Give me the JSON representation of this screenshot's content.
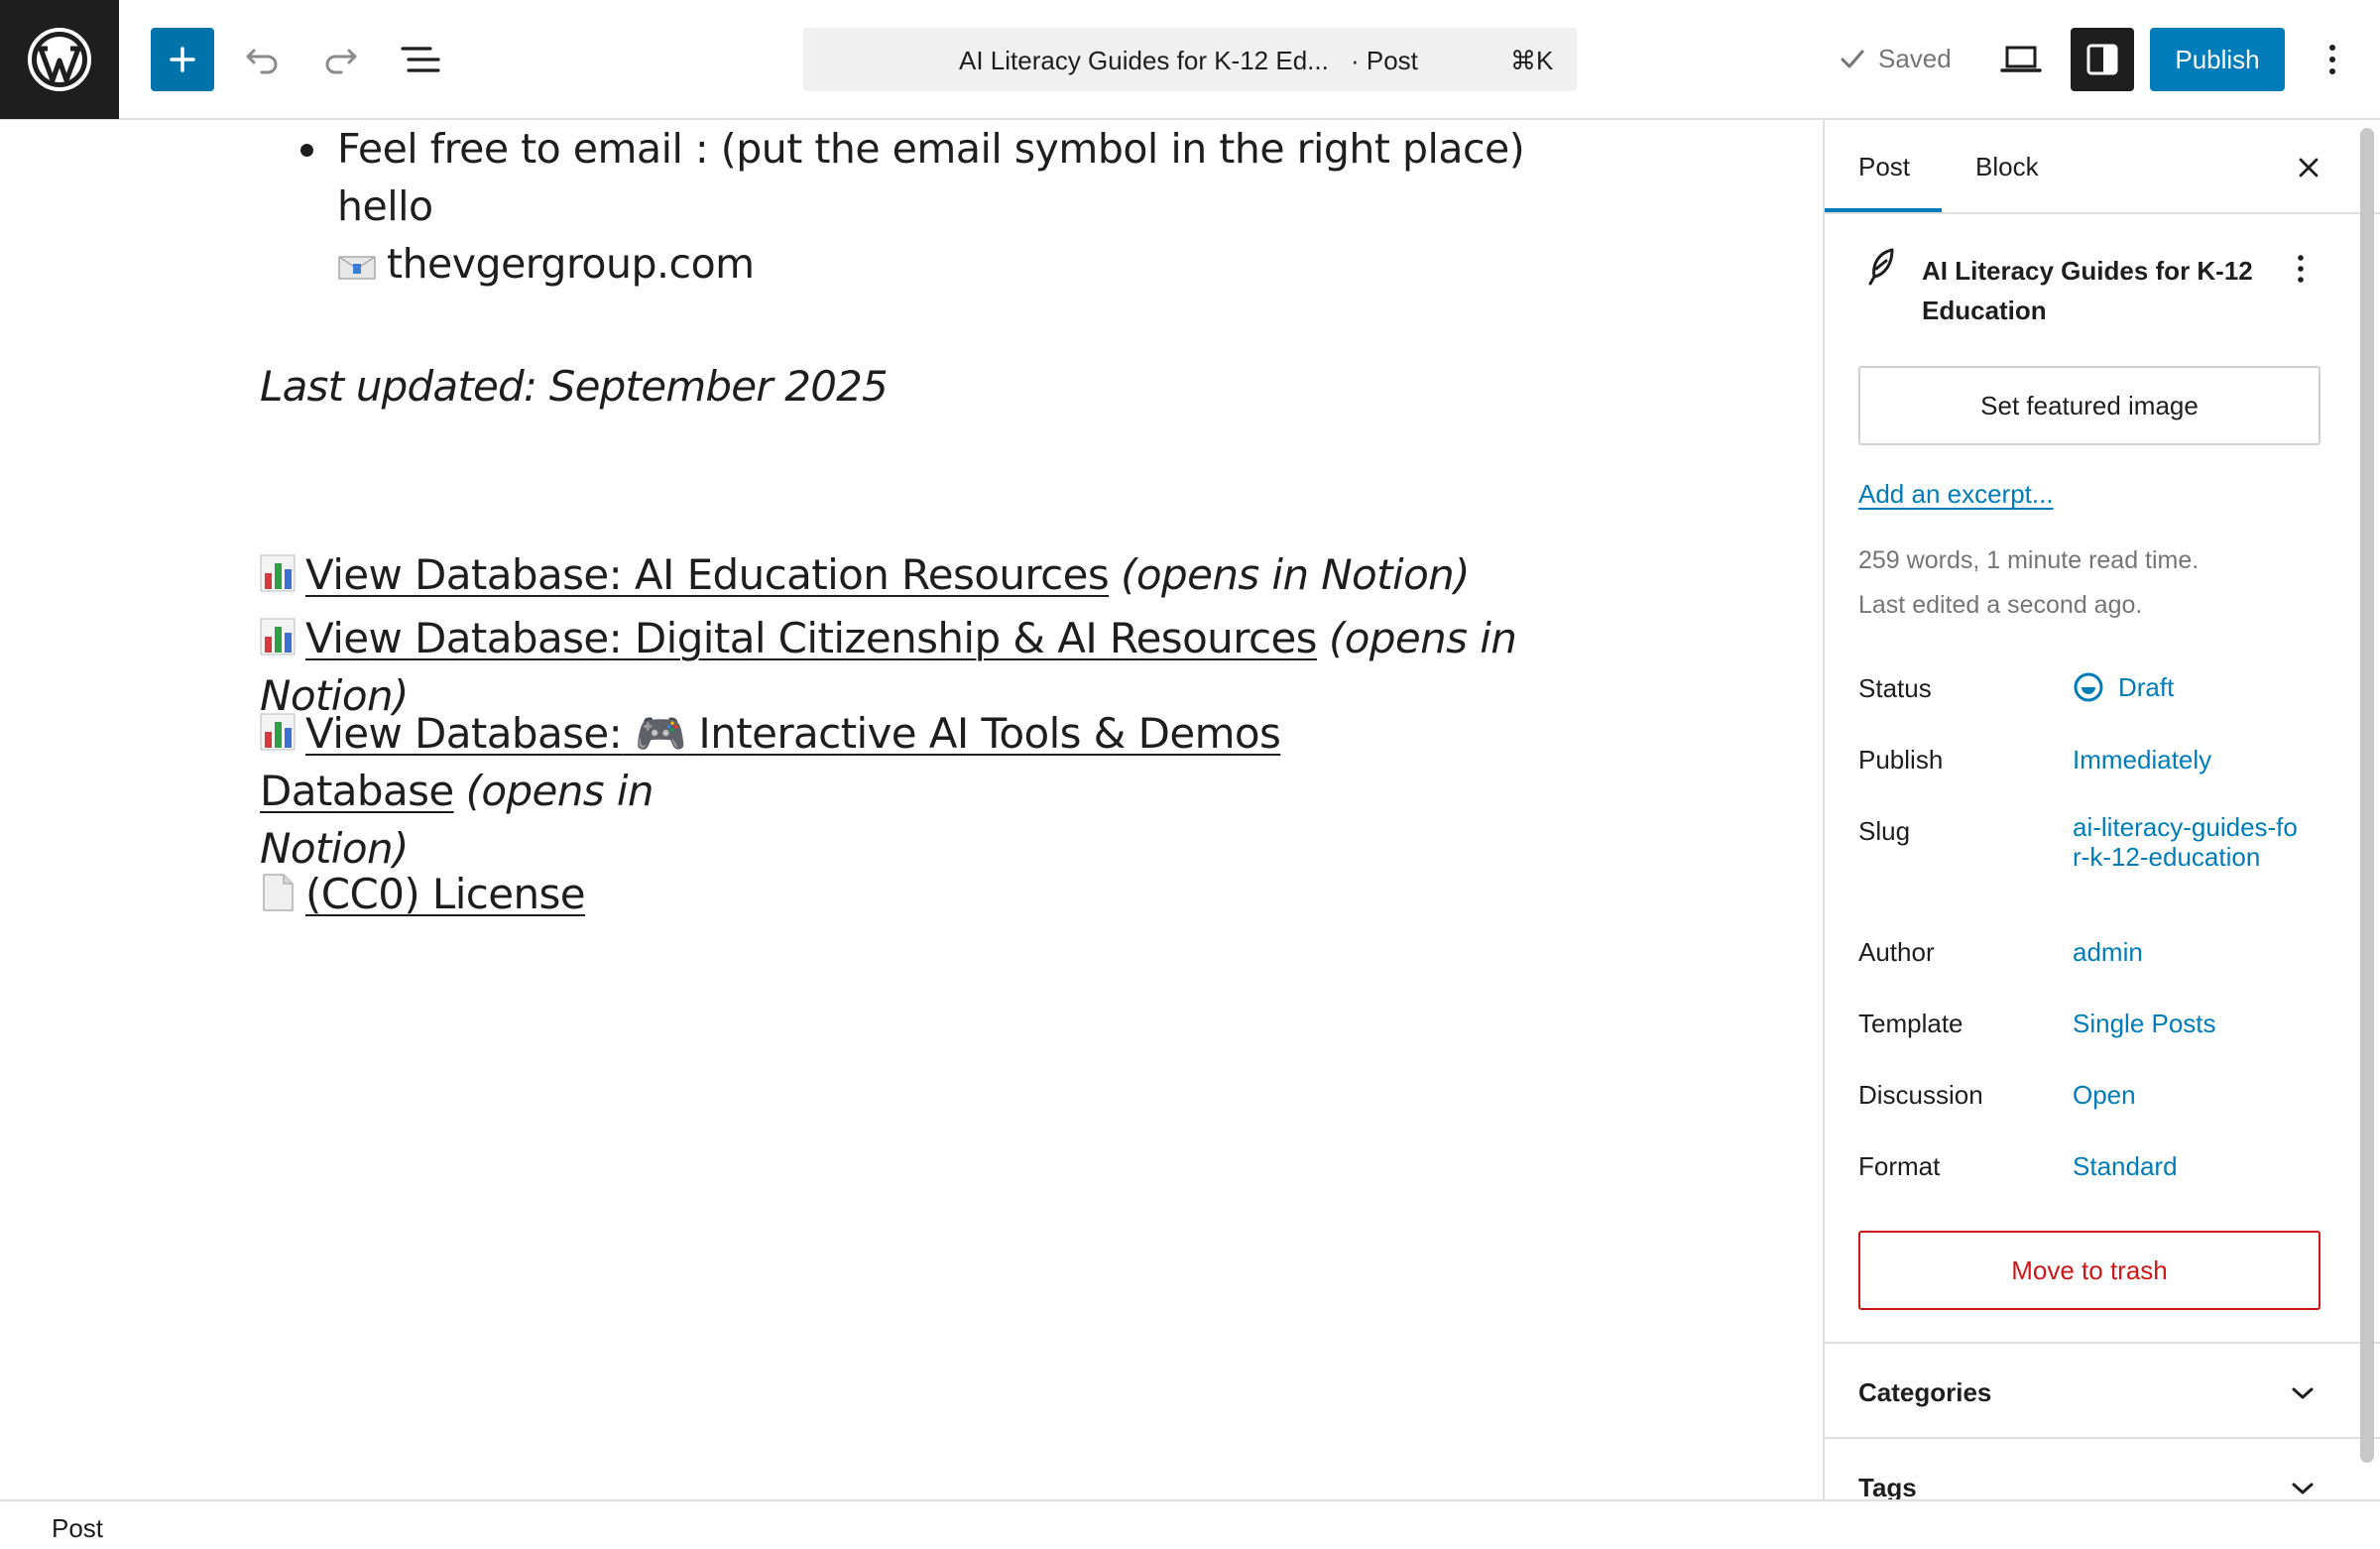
{
  "toolbar": {
    "logo_icon": "wordpress-logo-icon",
    "add_icon": "plus-icon",
    "undo_icon": "undo-icon",
    "redo_icon": "redo-icon",
    "list_view_icon": "list-view-icon",
    "command": {
      "title": "AI Literacy Guides for K-12 Ed...",
      "type": "· Post",
      "shortcut": "⌘K"
    },
    "saved_label": "Saved",
    "view_icon": "desktop-view-icon",
    "settings_icon": "sidebar-settings-icon",
    "publish_label": "Publish",
    "options_icon": "more-vertical-icon",
    "accent_color": "#007cba"
  },
  "content": {
    "bullet": {
      "line1": "Feel free to email : (put the email symbol in the right place)  hello",
      "line2": "thevgergroup.com"
    },
    "last_updated": "Last updated: September 2025",
    "databases": [
      {
        "link": "View Database: AI Education Resources",
        "note": "(opens in Notion)"
      },
      {
        "link": "View Database: Digital Citizenship & AI Resources",
        "note": "(opens in Notion)"
      },
      {
        "link_prefix": "View Database:",
        "link_emoji": "🎮",
        "link_suffix": "Interactive AI Tools & Demos Database",
        "note_part1": "(opens in",
        "note_part2": "Notion)"
      }
    ],
    "license": "(CC0) License"
  },
  "sidebar": {
    "tabs": [
      {
        "label": "Post",
        "active": true
      },
      {
        "label": "Block",
        "active": false
      }
    ],
    "post_title": "AI Literacy Guides for K-12 Education",
    "featured_image_label": "Set featured image",
    "excerpt_link": "Add an excerpt...",
    "word_count": "259 words, 1 minute read time.",
    "last_edited": "Last edited a second ago.",
    "rows": [
      {
        "label": "Status",
        "value": "Draft"
      },
      {
        "label": "Publish",
        "value": "Immediately"
      },
      {
        "label": "Slug",
        "value": "ai-literacy-guides-for-k-12-education"
      },
      {
        "label": "Author",
        "value": "admin"
      },
      {
        "label": "Template",
        "value": "Single Posts"
      },
      {
        "label": "Discussion",
        "value": "Open"
      },
      {
        "label": "Format",
        "value": "Standard"
      }
    ],
    "trash_label": "Move to trash",
    "panels": [
      {
        "title": "Categories"
      },
      {
        "title": "Tags"
      }
    ],
    "danger_color": "#cc1818"
  },
  "footer": {
    "breadcrumb": "Post"
  }
}
